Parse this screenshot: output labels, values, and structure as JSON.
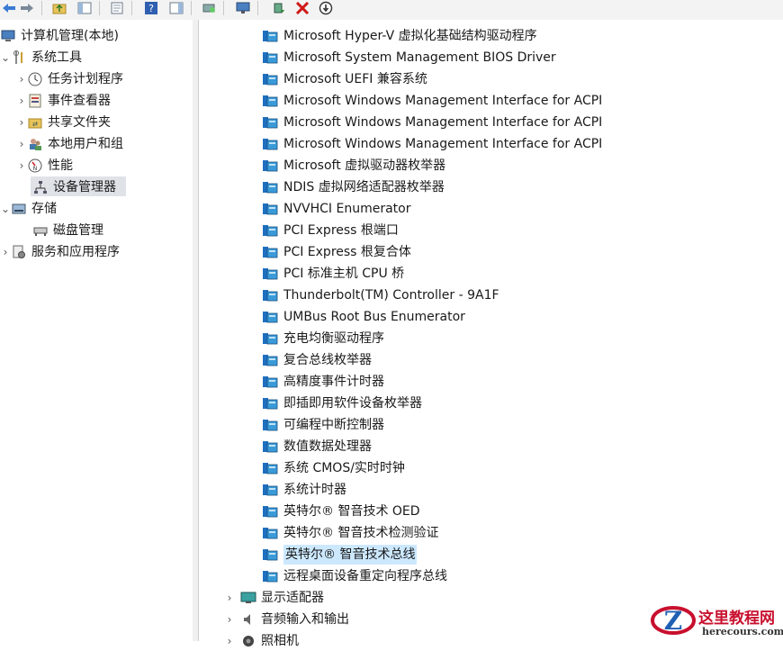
{
  "toolbar": {
    "icons": [
      "back-arrow-icon",
      "forward-arrow-icon",
      "up-folder-icon",
      "show-hide-tree-icon",
      "properties-icon",
      "help-icon",
      "show-hide-action-pane-icon",
      "scan-hardware-icon",
      "display-icon",
      "update-driver-icon",
      "uninstall-icon",
      "disable-device-icon"
    ]
  },
  "tree": {
    "root": "计算机管理(本地)",
    "system_tools": "系统工具",
    "task_scheduler": "任务计划程序",
    "event_viewer": "事件查看器",
    "shared_folders": "共享文件夹",
    "local_users": "本地用户和组",
    "performance": "性能",
    "device_manager": "设备管理器",
    "storage": "存储",
    "disk_management": "磁盘管理",
    "services_apps": "服务和应用程序"
  },
  "devices": [
    "Microsoft Hyper-V 虚拟化基础结构驱动程序",
    "Microsoft System Management BIOS Driver",
    "Microsoft UEFI 兼容系统",
    "Microsoft Windows Management Interface for ACPI",
    "Microsoft Windows Management Interface for ACPI",
    "Microsoft Windows Management Interface for ACPI",
    "Microsoft 虚拟驱动器枚举器",
    "NDIS 虚拟网络适配器枚举器",
    "NVVHCI Enumerator",
    "PCI Express 根端口",
    "PCI Express 根复合体",
    "PCI 标准主机 CPU 桥",
    "Thunderbolt(TM) Controller - 9A1F",
    "UMBus Root Bus Enumerator",
    "充电均衡驱动程序",
    "复合总线枚举器",
    "高精度事件计时器",
    "即插即用软件设备枚举器",
    "可编程中断控制器",
    "数值数据处理器",
    "系统 CMOS/实时时钟",
    "系统计时器",
    "英特尔® 智音技术 OED",
    "英特尔® 智音技术检测验证",
    "英特尔® 智音技术总线",
    "远程桌面设备重定向程序总线"
  ],
  "categories": {
    "display_adapters": "显示适配器",
    "audio_io": "音频输入和输出",
    "camera": "照相机"
  },
  "watermark": {
    "title": "这里教程网",
    "url": "herecours.com"
  },
  "colors": {
    "selection": "#cce8ff",
    "tree_selection": "#dfe3e8",
    "watermark_red": "#c8102e",
    "watermark_blue": "#1f5fb4"
  }
}
